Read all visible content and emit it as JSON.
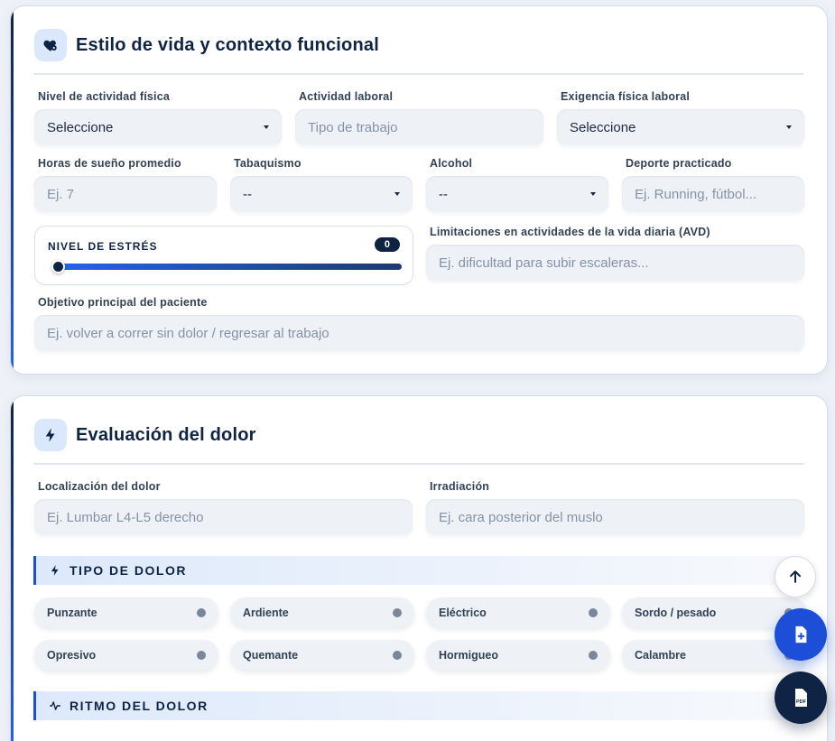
{
  "lifestyle": {
    "title": "Estilo de vida y contexto funcional",
    "icon": "heart-gear-icon",
    "activity_level": {
      "label": "Nivel de actividad física",
      "value": "Seleccione"
    },
    "work_activity": {
      "label": "Actividad laboral",
      "placeholder": "Tipo de trabajo"
    },
    "work_demand": {
      "label": "Exigencia física laboral",
      "value": "Seleccione"
    },
    "sleep_hours": {
      "label": "Horas de sueño promedio",
      "placeholder": "Ej. 7"
    },
    "smoking": {
      "label": "Tabaquismo",
      "value": "--"
    },
    "alcohol": {
      "label": "Alcohol",
      "value": "--"
    },
    "sport": {
      "label": "Deporte practicado",
      "placeholder": "Ej. Running, fútbol..."
    },
    "stress": {
      "label": "NIVEL DE ESTRÉS",
      "value": "0"
    },
    "avd_limitations": {
      "label": "Limitaciones en actividades de la vida diaria (AVD)",
      "placeholder": "Ej. dificultad para subir escaleras..."
    },
    "main_goal": {
      "label": "Objetivo principal del paciente",
      "placeholder": "Ej. volver a correr sin dolor / regresar al trabajo"
    }
  },
  "pain": {
    "title": "Evaluación del dolor",
    "icon": "bolt-icon",
    "location": {
      "label": "Localización del dolor",
      "placeholder": "Ej. Lumbar L4-L5 derecho"
    },
    "irradiation": {
      "label": "Irradiación",
      "placeholder": "Ej. cara posterior del muslo"
    },
    "type_section": "TIPO DE DOLOR",
    "types": [
      "Punzante",
      "Ardiente",
      "Eléctrico",
      "Sordo / pesado",
      "Opresivo",
      "Quemante",
      "Hormigueo",
      "Calambre"
    ],
    "rhythm_section": "RITMO DEL DOLOR"
  },
  "fabs": {
    "scroll_top": "arrow-up-icon",
    "add_document": "file-plus-icon",
    "pdf": "PDF"
  },
  "colors": {
    "navy": "#0f2344",
    "accent": "#1d4ed8",
    "field_bg": "#eef2f7"
  }
}
